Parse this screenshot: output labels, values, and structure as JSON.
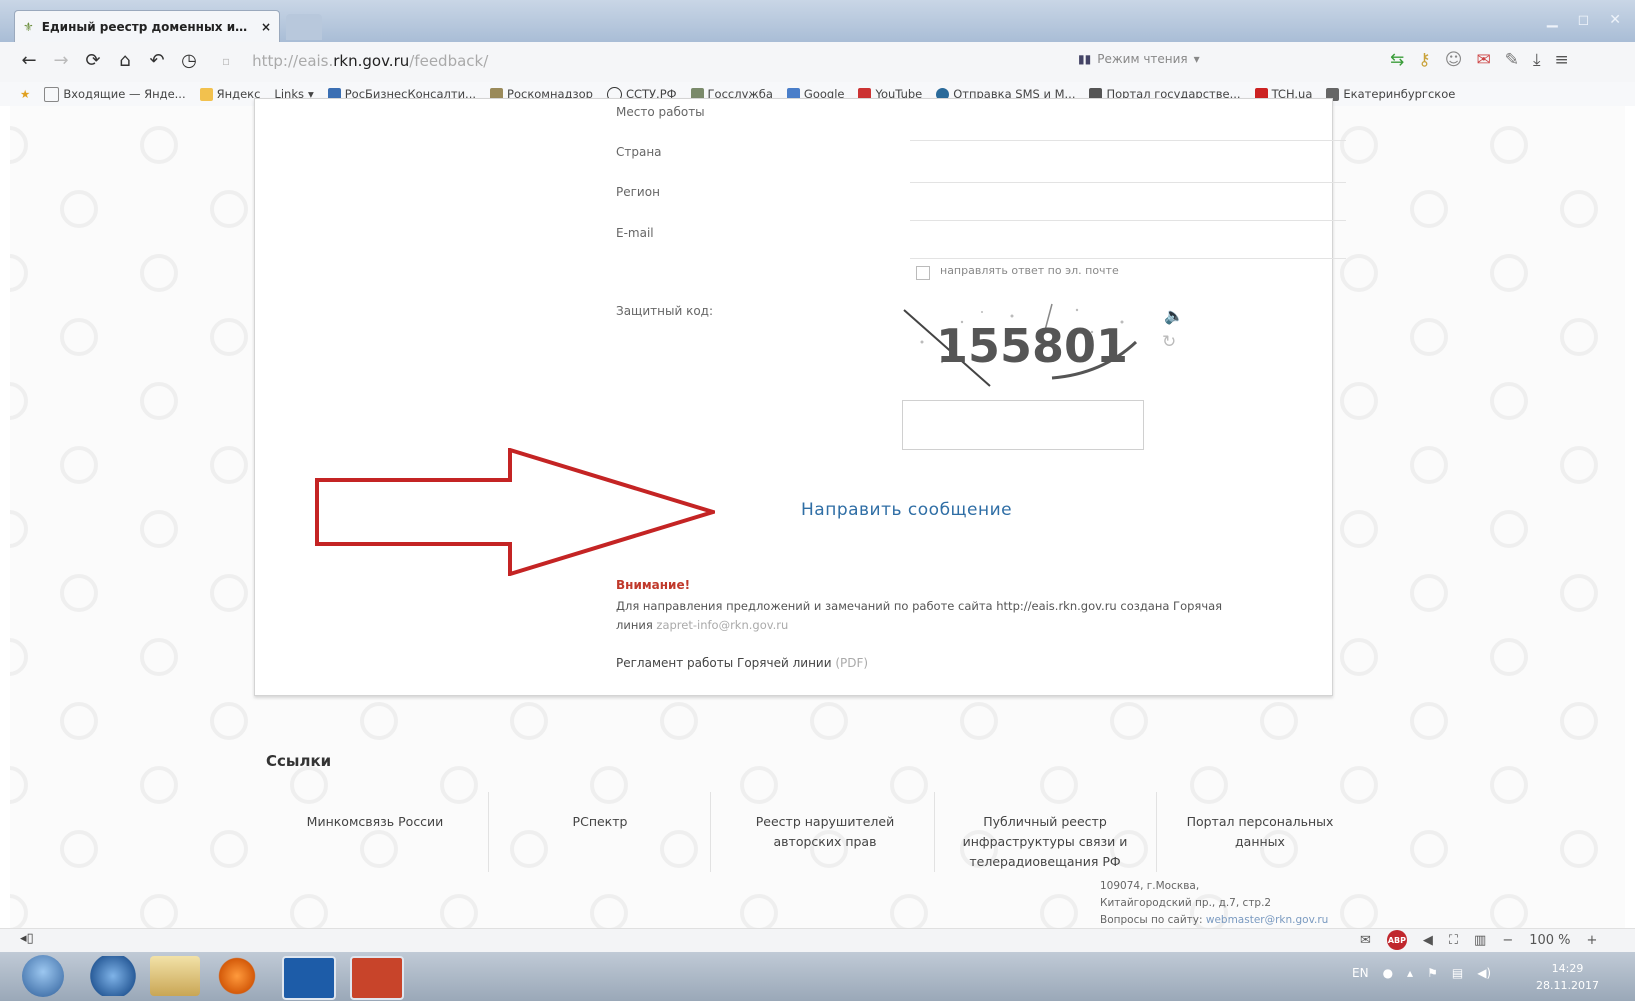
{
  "browser": {
    "tab_title": "Единый реестр доменных им...",
    "tab_close": "×",
    "url_prefix": "http://eais.",
    "url_host": "rkn.gov.ru",
    "url_path": "/feedback/",
    "reading_mode": "Режим чтения",
    "bookmarks": [
      {
        "label": "Входящие — Янде..."
      },
      {
        "label": "Яндекс"
      },
      {
        "label": "Links"
      },
      {
        "label": "РосБизнесКонсалти..."
      },
      {
        "label": "Роскомнадзор"
      },
      {
        "label": "ССТУ.РФ"
      },
      {
        "label": "Госслужба"
      },
      {
        "label": "Google"
      },
      {
        "label": "YouTube"
      },
      {
        "label": "Отправка SMS и М..."
      },
      {
        "label": "Портал государстве..."
      },
      {
        "label": "TCH.ua"
      },
      {
        "label": "Екатеринбургское"
      }
    ]
  },
  "form": {
    "work_label": "Место работы",
    "country_label": "Страна",
    "region_label": "Регион",
    "email_label": "E-mail",
    "reply_checkbox_label": "направлять ответ по эл. почте",
    "captcha_label": "Защитный код:",
    "captcha_code": "155801",
    "submit_label": "Направить сообщение"
  },
  "notice": {
    "title": "Внимание!",
    "text": "Для направления предложений и замечаний по работе сайта http://eais.rkn.gov.ru создана Горячая",
    "text_line2": "линия",
    "email": "zapret-info@rkn.gov.ru",
    "regulation": "Регламент работы Горячей линии",
    "regulation_pdf": "(PDF)"
  },
  "footer": {
    "links_title": "Ссылки",
    "links": [
      {
        "label": "Минкомсвязь России"
      },
      {
        "label": "РСпектр"
      },
      {
        "label": "Реестр нарушителей авторских прав"
      },
      {
        "label": "Публичный реестр инфраструктуры связи и телерадиовещания РФ"
      },
      {
        "label": "Портал персональных данных"
      }
    ],
    "address_line1": "109074, г.Москва,",
    "address_line2": "Китайгородский пр., д.7, стр.2",
    "address_line3": "Вопросы по сайту:",
    "address_email": "webmaster@rkn.gov.ru"
  },
  "statusbar": {
    "zoom": "100 %"
  },
  "taskbar": {
    "lang": "EN",
    "time": "14:29",
    "date": "28.11.2017"
  },
  "colors": {
    "arrow": "#c42424",
    "link_blue": "#2f6ea5",
    "notice_red": "#c0392b"
  }
}
